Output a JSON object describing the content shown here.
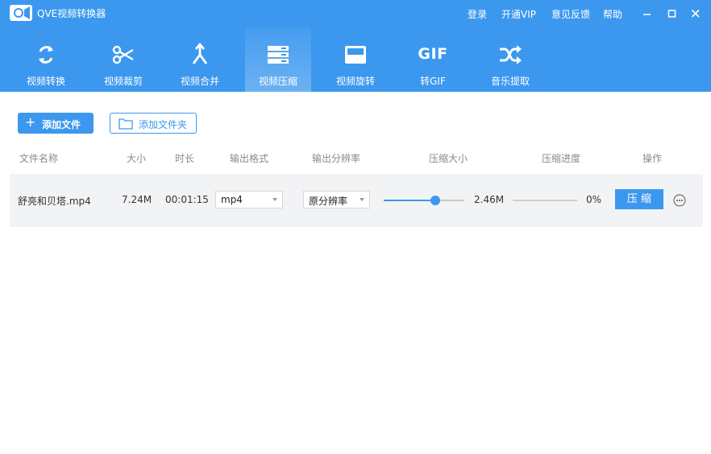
{
  "app": {
    "title": "QVE视频转换器"
  },
  "top_links": [
    "登录",
    "开通VIP",
    "意见反馈",
    "帮助"
  ],
  "window_controls": [
    "minimize-icon",
    "maximize-icon",
    "close-icon"
  ],
  "toolbar": {
    "tabs": [
      {
        "label": "视频转换",
        "icon": "convert-icon"
      },
      {
        "label": "视频裁剪",
        "icon": "scissors-icon"
      },
      {
        "label": "视频合并",
        "icon": "merge-icon"
      },
      {
        "label": "视频压缩",
        "icon": "compress-icon",
        "active": true
      },
      {
        "label": "视频旋转",
        "icon": "rotate-icon"
      },
      {
        "label": "转GIF",
        "icon": "gif-icon",
        "icon_text": "GIF"
      },
      {
        "label": "音乐提取",
        "icon": "shuffle-icon"
      }
    ]
  },
  "actions": {
    "add_file": "添加文件",
    "add_folder": "添加文件夹"
  },
  "columns": [
    "文件名称",
    "大小",
    "时长",
    "输出格式",
    "输出分辨率",
    "压缩大小",
    "压缩进度",
    "操作"
  ],
  "files": [
    {
      "name": "舒亮和贝塔.mp4",
      "size": "7.24M",
      "duration": "00:01:15",
      "output_format": "mp4",
      "output_resolution": "原分辨率",
      "compress_ratio": 0.64,
      "compressed_size": "2.46M",
      "progress_text": "0%",
      "progress": 0,
      "action_label": "压 缩"
    }
  ],
  "colors": {
    "accent": "#3b98ee",
    "row_bg": "#f2f3f5"
  }
}
